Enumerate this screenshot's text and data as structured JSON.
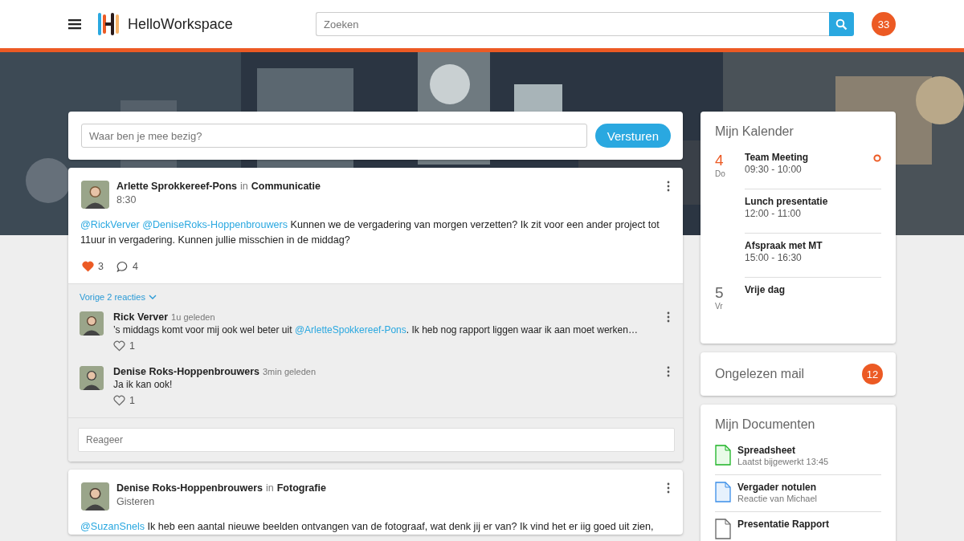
{
  "header": {
    "app_name": "HelloWorkspace",
    "search": {
      "placeholder": "Zoeken"
    },
    "notifications": "33"
  },
  "composer": {
    "placeholder": "Waar ben je mee bezig?",
    "button": "Versturen"
  },
  "posts": [
    {
      "author": "Arlette Sprokkereef-Pons",
      "in": "in",
      "group": "Communicatie",
      "time": "8:30",
      "body": [
        {
          "kind": "mention",
          "text": "@RickVerver"
        },
        {
          "kind": "mention",
          "text": "@DeniseRoks-Hoppenbrouwers"
        },
        {
          "kind": "text",
          "text": " Kunnen we de vergadering van morgen verzetten? Ik zit voor een ander project tot 11uur in vergadering. Kunnen jullie misschien in de middag?"
        }
      ],
      "likes": "3",
      "liked": true,
      "comment_count": "4",
      "discussion": {
        "more": "Vorige 2 reacties",
        "comments": [
          {
            "author": "Rick Verver",
            "time": "1u geleden",
            "body": [
              {
                "kind": "text",
                "text": "’s middags komt voor mij ook wel beter uit "
              },
              {
                "kind": "mention",
                "text": "@ArletteSpokkereef-Pons"
              },
              {
                "kind": "text",
                "text": ". Ik heb nog rapport liggen waar ik aan moet werken…"
              }
            ],
            "likes": "1",
            "liked": false
          },
          {
            "author": "Denise Roks-Hoppenbrouwers",
            "time": "3min geleden",
            "body": [
              {
                "kind": "text",
                "text": "Ja ik kan ook!"
              }
            ],
            "likes": "1",
            "liked": false
          }
        ],
        "reply_placeholder": "Reageer"
      }
    },
    {
      "author": "Denise Roks-Hoppenbrouwers",
      "in": "in",
      "group": "Fotografie",
      "time": "Gisteren",
      "body": [
        {
          "kind": "mention",
          "text": "@SuzanSnels"
        },
        {
          "kind": "text",
          "text": " Ik heb een aantal nieuwe beelden ontvangen van de fotograaf, wat denk jij er van? Ik vind het er iig goed uit zien,"
        }
      ]
    }
  ],
  "calendar": {
    "title": "Mijn Kalender",
    "days": [
      {
        "day": "4",
        "weekday": "Do",
        "today": true,
        "events": [
          {
            "title": "Team Meeting",
            "time": "09:30 - 10:00",
            "current": true
          },
          {
            "title": "Lunch presentatie",
            "time": "12:00 - 11:00",
            "current": false
          },
          {
            "title": "Afspraak met MT",
            "time": "15:00 - 16:30",
            "current": false
          }
        ]
      },
      {
        "day": "5",
        "weekday": "Vr",
        "today": false,
        "events": [
          {
            "title": "Vrije dag",
            "current": false
          }
        ]
      }
    ]
  },
  "mail": {
    "title": "Ongelezen mail",
    "count": "12"
  },
  "documents": {
    "title": "Mijn Documenten",
    "items": [
      {
        "kind": "spreadsheet",
        "name": "Spreadsheet",
        "meta": "Laatst bijgewerkt 13:45"
      },
      {
        "kind": "document",
        "name": "Vergader notulen",
        "meta": "Reactie van Michael"
      },
      {
        "kind": "presentation",
        "name": "Presentatie Rapport"
      }
    ]
  }
}
